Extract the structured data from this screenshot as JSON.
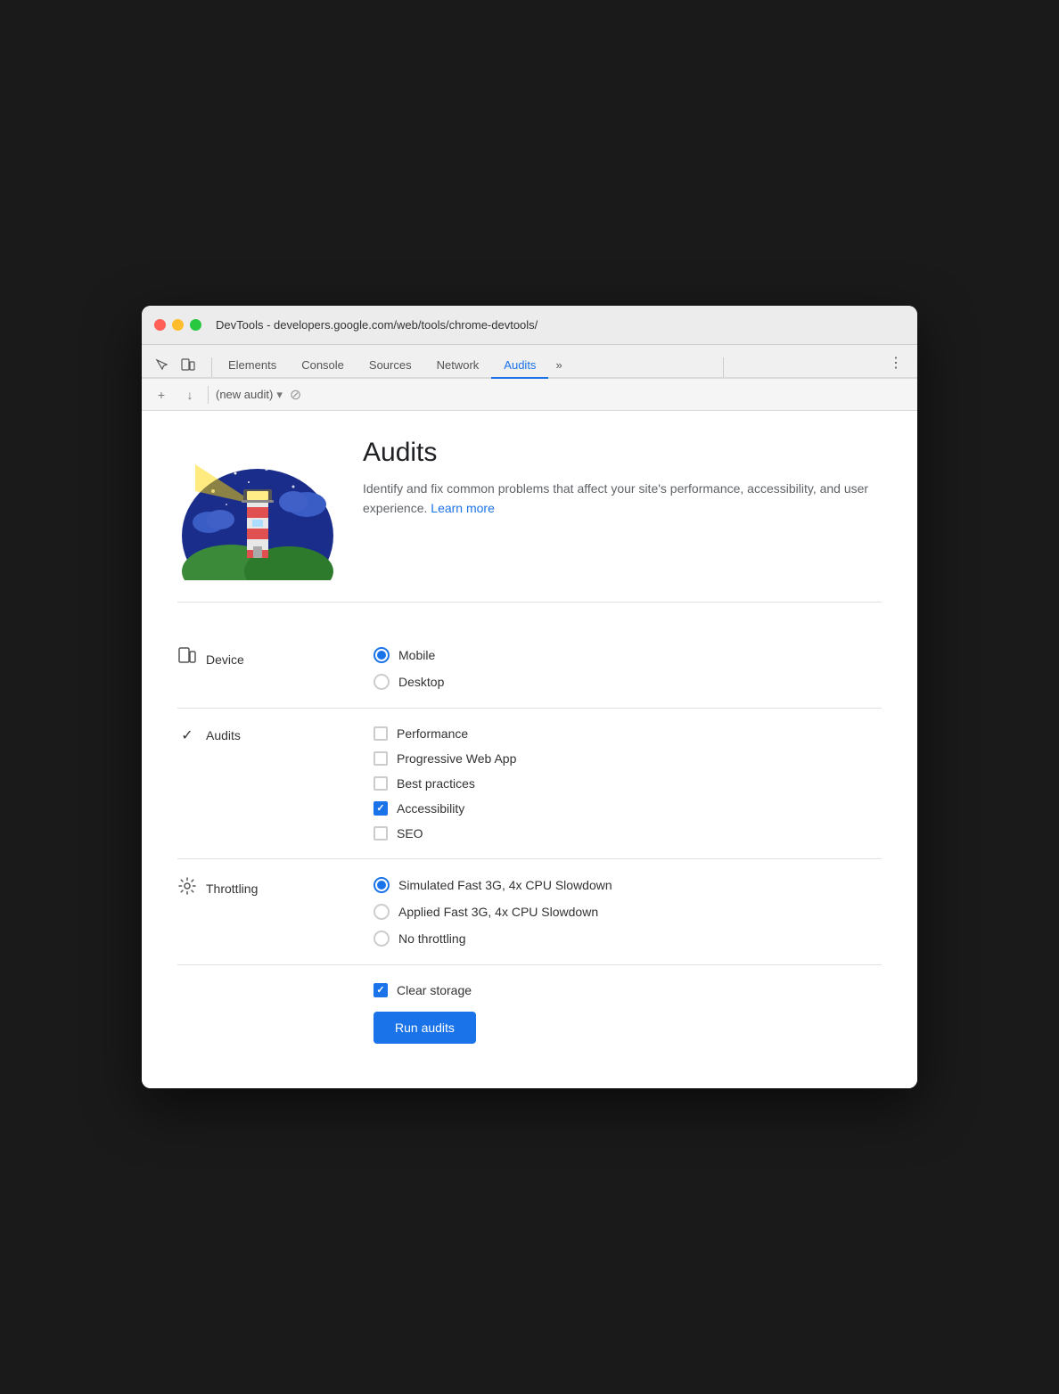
{
  "window": {
    "title": "DevTools - developers.google.com/web/tools/chrome-devtools/"
  },
  "titlebar": {
    "title": "DevTools - developers.google.com/web/tools/chrome-devtools/"
  },
  "tabs": {
    "items": [
      {
        "label": "Elements",
        "active": false
      },
      {
        "label": "Console",
        "active": false
      },
      {
        "label": "Sources",
        "active": false
      },
      {
        "label": "Network",
        "active": false
      },
      {
        "label": "Audits",
        "active": true
      }
    ],
    "more_label": "»",
    "menu_label": "⋮"
  },
  "audit_toolbar": {
    "add_label": "+",
    "download_label": "↓",
    "select_placeholder": "(new audit)",
    "block_icon": "⊘"
  },
  "hero": {
    "title": "Audits",
    "description": "Identify and fix common problems that affect your site's performance, accessibility, and user experience.",
    "learn_more": "Learn more"
  },
  "device_section": {
    "label": "Device",
    "options": [
      {
        "label": "Mobile",
        "selected": true
      },
      {
        "label": "Desktop",
        "selected": false
      }
    ]
  },
  "audits_section": {
    "label": "Audits",
    "options": [
      {
        "label": "Performance",
        "checked": false
      },
      {
        "label": "Progressive Web App",
        "checked": false
      },
      {
        "label": "Best practices",
        "checked": false
      },
      {
        "label": "Accessibility",
        "checked": true
      },
      {
        "label": "SEO",
        "checked": false
      }
    ]
  },
  "throttling_section": {
    "label": "Throttling",
    "options": [
      {
        "label": "Simulated Fast 3G, 4x CPU Slowdown",
        "selected": true
      },
      {
        "label": "Applied Fast 3G, 4x CPU Slowdown",
        "selected": false
      },
      {
        "label": "No throttling",
        "selected": false
      }
    ]
  },
  "clear_storage": {
    "label": "Clear storage",
    "checked": true
  },
  "run_button": {
    "label": "Run audits"
  }
}
